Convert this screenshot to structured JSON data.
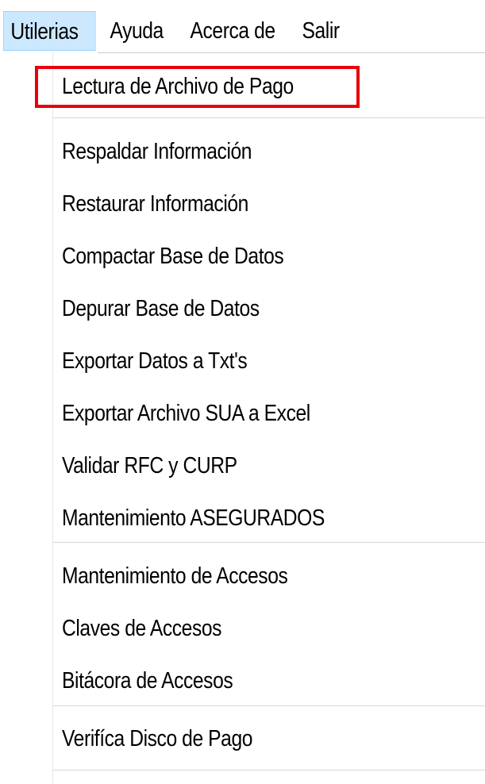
{
  "menubar": {
    "items": [
      {
        "label": "Utilerias",
        "active": true
      },
      {
        "label": "Ayuda"
      },
      {
        "label": "Acerca de"
      },
      {
        "label": "Salir"
      }
    ]
  },
  "dropdown": {
    "groups": [
      [
        "Lectura de Archivo de Pago"
      ],
      [
        "Respaldar Información",
        "Restaurar Información",
        "Compactar Base de Datos",
        "Depurar Base de Datos",
        "Exportar Datos a Txt's",
        "Exportar Archivo SUA a Excel",
        "Validar RFC y CURP",
        "Mantenimiento ASEGURADOS"
      ],
      [
        "Mantenimiento de Accesos",
        "Claves de Accesos",
        "Bitácora de Accesos"
      ],
      [
        "Verifíca Disco de Pago"
      ]
    ]
  },
  "highlight": {
    "color": "#e8000b",
    "target": "Lectura de Archivo de Pago"
  },
  "colors": {
    "menubar_active_bg": "#cce8ff",
    "menubar_active_border": "#99d1ff",
    "separator": "#d7d7d7"
  }
}
